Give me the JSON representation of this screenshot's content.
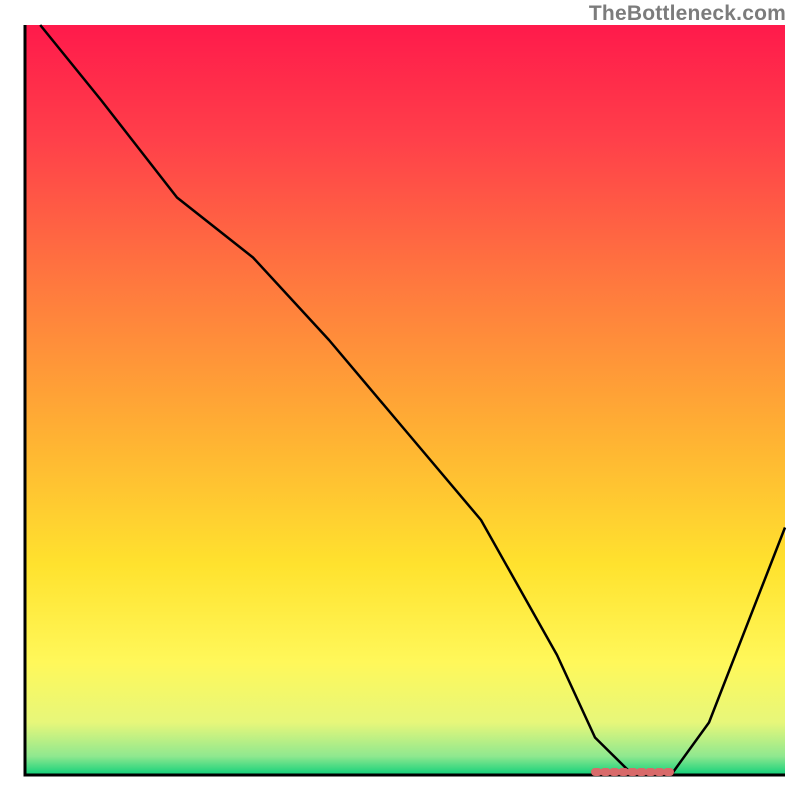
{
  "watermark": "TheBottleneck.com",
  "chart_data": {
    "type": "line",
    "title": "",
    "xlabel": "",
    "ylabel": "",
    "xlim": [
      0,
      100
    ],
    "ylim": [
      0,
      100
    ],
    "series": [
      {
        "name": "curve",
        "x": [
          2,
          10,
          20,
          25,
          30,
          40,
          50,
          60,
          70,
          75,
          80,
          85,
          90,
          100
        ],
        "y": [
          100,
          90,
          77,
          73,
          69,
          58,
          46,
          34,
          16,
          5,
          0,
          0,
          7,
          33
        ]
      }
    ],
    "flat_segment": {
      "x_start": 75,
      "x_end": 85,
      "y": 0,
      "color": "#d86a6a"
    },
    "background_gradient": {
      "stops": [
        {
          "offset": 0.0,
          "color": "#ff1a4b"
        },
        {
          "offset": 0.15,
          "color": "#ff3f4a"
        },
        {
          "offset": 0.35,
          "color": "#ff7a3e"
        },
        {
          "offset": 0.55,
          "color": "#ffb233"
        },
        {
          "offset": 0.72,
          "color": "#ffe22e"
        },
        {
          "offset": 0.85,
          "color": "#fff85a"
        },
        {
          "offset": 0.93,
          "color": "#e7f77a"
        },
        {
          "offset": 0.975,
          "color": "#8fe88f"
        },
        {
          "offset": 1.0,
          "color": "#10d07a"
        }
      ]
    },
    "axis_color": "#000000",
    "curve_color": "#000000"
  }
}
